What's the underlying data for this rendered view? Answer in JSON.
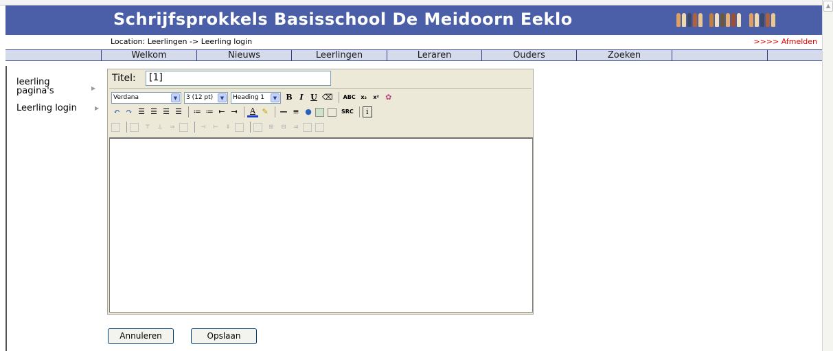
{
  "header": {
    "title": "Schrijfsprokkels Basisschool De Meidoorn Eeklo"
  },
  "location": {
    "text": "Location: Leerlingen -> Leerling login",
    "logout": ">>>> Afmelden"
  },
  "nav": {
    "items": [
      "Welkom",
      "Nieuws",
      "Leerlingen",
      "Leraren",
      "Ouders",
      "Zoeken"
    ]
  },
  "sidebar": {
    "items": [
      {
        "label_line1": "leerling",
        "label_line2": "pagina's"
      },
      {
        "label_line1": "Leerling login"
      }
    ]
  },
  "editor": {
    "title_label": "Titel:",
    "title_value": "[1]",
    "font_family": "Verdana",
    "font_size": "3 (12 pt)",
    "block_format": "Heading 1",
    "content": ""
  },
  "buttons": {
    "cancel": "Annuleren",
    "save": "Opslaan"
  },
  "colors": {
    "banner": "#4a5fa7",
    "nav_bg": "#d6dbec",
    "logout": "#e00000",
    "editor_bg": "#ece9d8"
  }
}
